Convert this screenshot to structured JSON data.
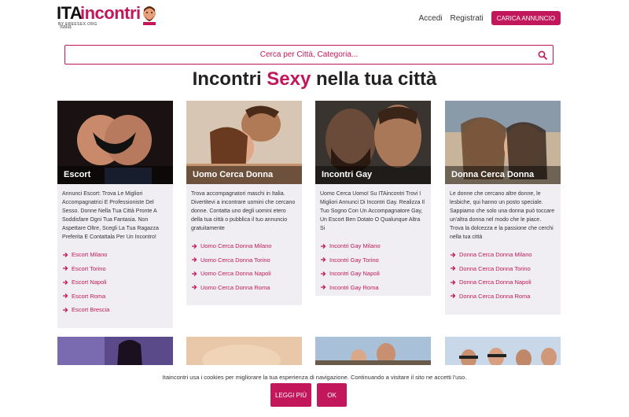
{
  "header": {
    "logo_ita": "ITA",
    "logo_incontri": "incontri",
    "logo_sub": "BY FREESEX.ORG",
    "country": "Italia",
    "nav": {
      "login": "Accedi",
      "register": "Registrati",
      "upload": "CARICA ANNUNCIO"
    }
  },
  "search": {
    "placeholder": "Cerca per Città, Categoria..."
  },
  "title": {
    "part1": "Incontri ",
    "accent": "Sexy",
    "part2": " nella tua città"
  },
  "cards": [
    {
      "label": "Escort",
      "description": "Annunci Escort: Trova Le Migliori Accompagnatrici E Professioniste Del Sesso. Donne Nella Tua Città Pronte A Soddisfare Ogni Tua Fantasia. Non Aspettare Oltre, Scegli La Tua Ragazza Preferita E Contattala Per Un Incontro!",
      "links": [
        "Escort Milano",
        "Escort Torino",
        "Escort Napoli",
        "Escort Roma",
        "Escort Brescia"
      ]
    },
    {
      "label": "Uomo Cerca Donna",
      "description": "Trova accompagnatori maschi in Italia. Divertitevi a incontrare uomini che cercano donne. Contatta uno degli uomini etero della tua città o pubblica il tuo annuncio gratuitamente",
      "links": [
        "Uomo Cerca Donna Milano",
        "Uomo Cerca Donna Torino",
        "Uomo Cerca Donna Napoli",
        "Uomo Cerca Donna Roma"
      ]
    },
    {
      "label": "Incontri Gay",
      "description": "Uomo Cerca Uomo! Su ITAincontri Trovi I Migliori Annunci Di Incontri Gay. Realizza Il Tuo Sogno Con Un Accompagnatore Gay, Un Escort Ben Dotato O Qualunque Altra Si",
      "links": [
        "Incontri Gay Milano",
        "Incontri Gay Torino",
        "Incontri Gay Napoli",
        "Incontri Gay Roma"
      ]
    },
    {
      "label": "Donna Cerca Donna",
      "description": "Le donne che cercano altre donne, le lesbiche, qui hanno un posto speciale. Sappiamo che solo una donna può toccare un'altra donna nel modo che le piace. Trova la dolcezza e la passione che cerchi nella tua città",
      "links": [
        "Donna Cerca Donna Milano",
        "Donna Cerca Donna Torino",
        "Donna Cerca Donna Napoli",
        "Donna Cerca Donna Roma"
      ]
    }
  ],
  "cookie": {
    "text": "Itaincontri usa i cookies per migliorare la tua esperienza di navigazione. Continuando a visitare il sito ne accetti l'uso.",
    "more": "LEGGI PIÙ",
    "ok": "OK"
  },
  "colors": {
    "accent": "#c2185b",
    "card_bg": "#f0eef2"
  }
}
